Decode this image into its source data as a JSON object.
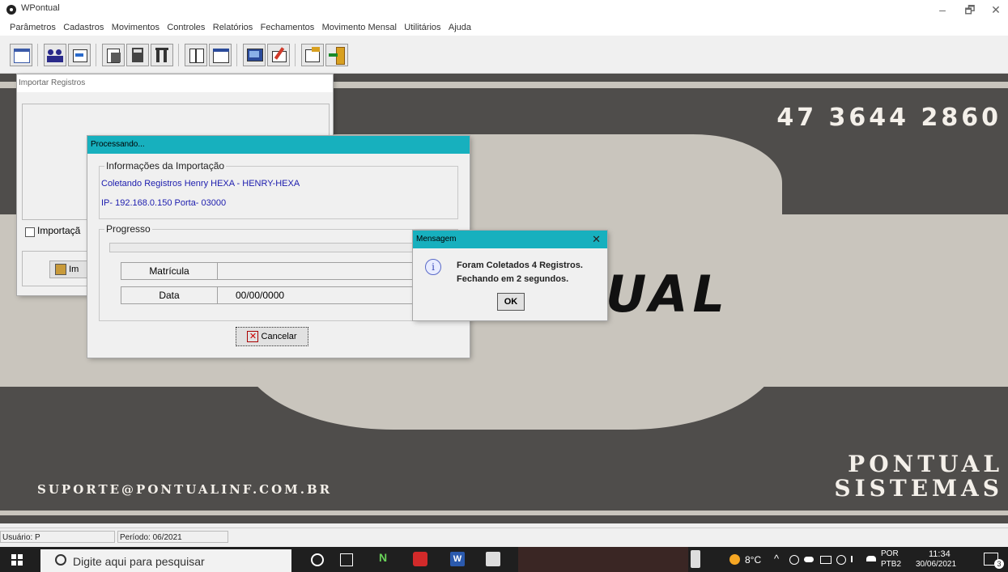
{
  "window": {
    "title": "WPontual",
    "minimize": "–",
    "maximize": "🗗",
    "close": "✕"
  },
  "menu": [
    "Parâmetros",
    "Cadastros",
    "Movimentos",
    "Controles",
    "Relatórios",
    "Fechamentos",
    "Movimento Mensal",
    "Utilitários",
    "Ajuda"
  ],
  "background": {
    "phone": "47 3644 2860",
    "email": "SUPORTE@PONTUALINF.COM.BR",
    "brand_line1": "PONTUAL",
    "brand_line2": "SISTEMAS",
    "big_text": "UAL"
  },
  "import_window": {
    "title": "Importar Registros",
    "checkbox_label": "Importaçã",
    "button_label": "Im"
  },
  "processing": {
    "title": "Processando...",
    "info_legend": "Informações da Importação",
    "info_line1": "Coletando Registros Henry HEXA  - HENRY-HEXA",
    "info_line2": "IP- 192.168.0.150   Porta- 03000",
    "progress_legend": "Progresso",
    "progress_value": 0,
    "matricula_label": "Matrícula",
    "matricula_value": "",
    "data_label": "Data",
    "data_value": "00/00/0000",
    "cancel_label": "Cancelar"
  },
  "message": {
    "title": "Mensagem",
    "close": "✕",
    "line1": "Foram Coletados 4 Registros.",
    "line2": "Fechando em 2 segundos.",
    "ok_label": "OK"
  },
  "status": {
    "user": "Usuário: P",
    "period": "Período: 06/2021"
  },
  "taskbar": {
    "search_placeholder": "Digite aqui para pesquisar",
    "weather": "8°C",
    "lang1": "POR",
    "lang2": "PTB2",
    "time": "11:34",
    "date": "30/06/2021",
    "notifications": "3"
  },
  "colors": {
    "accent": "#17b0be",
    "bg_dark": "#4f4d4b",
    "bg_light": "#c9c5bd",
    "info_text": "#1c1cae"
  }
}
